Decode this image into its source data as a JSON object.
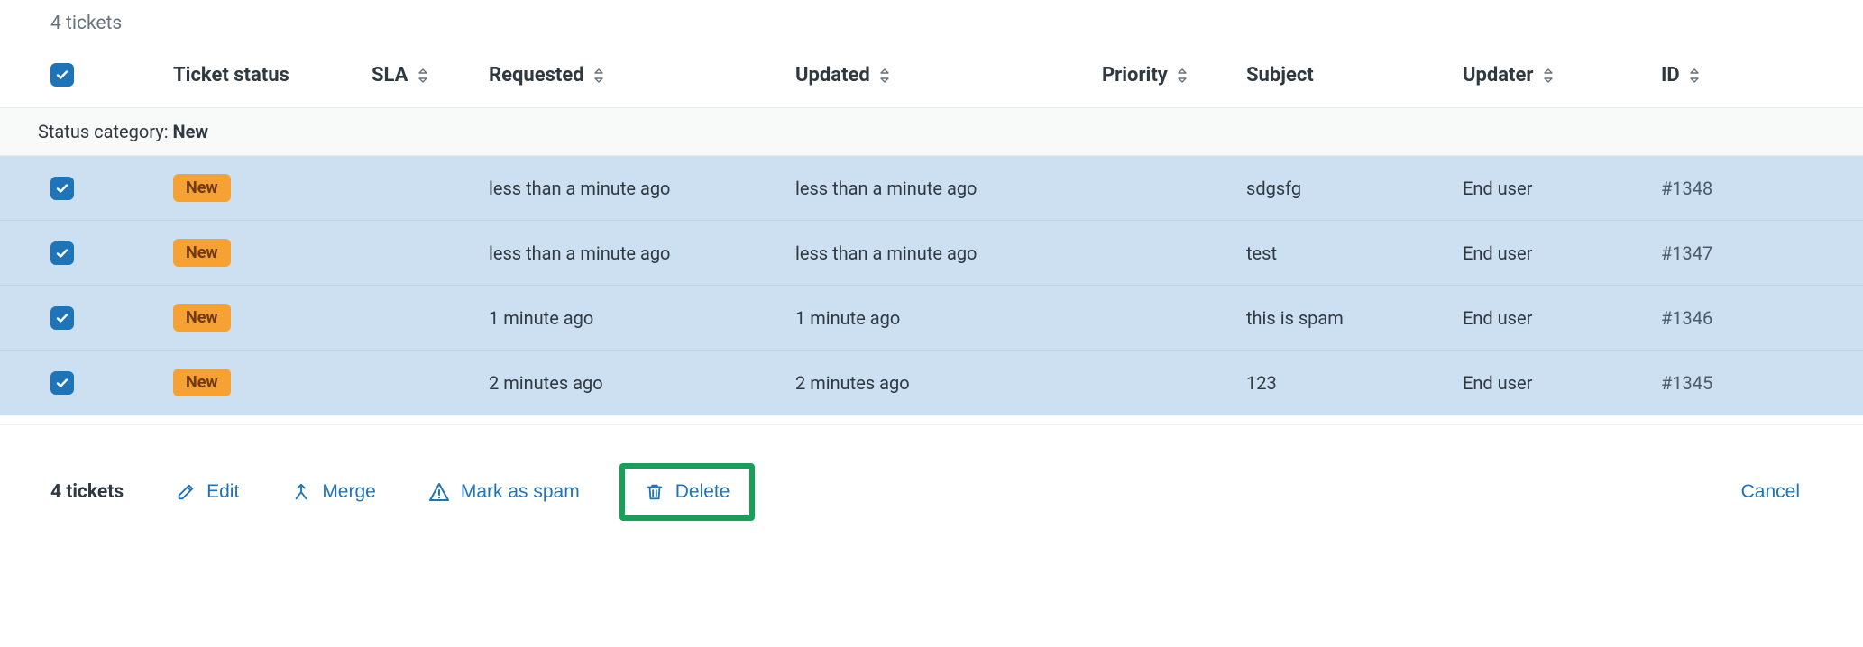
{
  "header": {
    "ticket_count": "4 tickets"
  },
  "columns": {
    "ticket_status": "Ticket status",
    "sla": "SLA",
    "requested": "Requested",
    "updated": "Updated",
    "priority": "Priority",
    "subject": "Subject",
    "updater": "Updater",
    "id": "ID"
  },
  "group": {
    "label": "Status category: ",
    "value": "New"
  },
  "rows": [
    {
      "status": "New",
      "sla": "",
      "requested": "less than a minute ago",
      "updated": "less than a minute ago",
      "priority": "",
      "subject": "sdgsfg",
      "updater": "End user",
      "id": "#1348"
    },
    {
      "status": "New",
      "sla": "",
      "requested": "less than a minute ago",
      "updated": "less than a minute ago",
      "priority": "",
      "subject": "test",
      "updater": "End user",
      "id": "#1347"
    },
    {
      "status": "New",
      "sla": "",
      "requested": "1 minute ago",
      "updated": "1 minute ago",
      "priority": "",
      "subject": "this is spam",
      "updater": "End user",
      "id": "#1346"
    },
    {
      "status": "New",
      "sla": "",
      "requested": "2 minutes ago",
      "updated": "2 minutes ago",
      "priority": "",
      "subject": "123",
      "updater": "End user",
      "id": "#1345"
    }
  ],
  "footer": {
    "count": "4 tickets",
    "edit": "Edit",
    "merge": "Merge",
    "mark_as_spam": "Mark as spam",
    "delete": "Delete",
    "cancel": "Cancel"
  }
}
